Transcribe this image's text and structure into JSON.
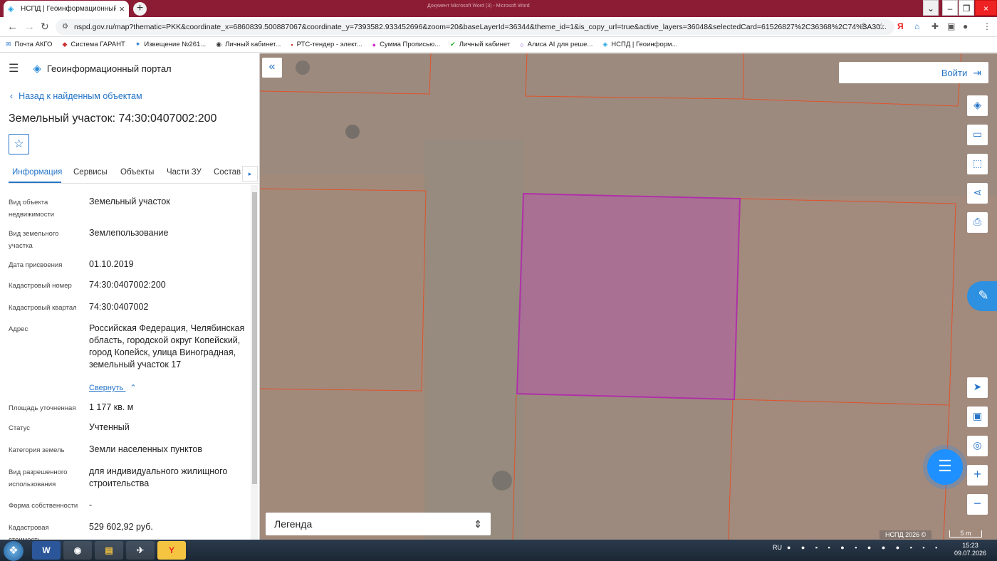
{
  "browser": {
    "tab_title": "НСПД | Геоинформационный п",
    "window_title": "Документ Microsoft Word (3) - Microsoft Word",
    "url": "nspd.gov.ru/map?thematic=PKK&coordinate_x=6860839.500887067&coordinate_y=7393582.933452696&zoom=20&baseLayerId=36344&theme_id=1&is_copy_url=true&active_layers=36048&selectedCard=61526827%2C36368%2C74%3A30..."
  },
  "bookmarks": [
    {
      "label": "Почта АКГО"
    },
    {
      "label": "Система ГАРАНТ"
    },
    {
      "label": "Извещение №261..."
    },
    {
      "label": "Личный кабинет..."
    },
    {
      "label": "РТС-тендер - элект..."
    },
    {
      "label": "Сумма Прописью..."
    },
    {
      "label": "Личный кабинет"
    },
    {
      "label": "Алиса AI для реше..."
    },
    {
      "label": "НСПД | Геоинформ..."
    }
  ],
  "portal": {
    "title": "Геоинформационный портал"
  },
  "panel": {
    "back_link": "Назад к найденным объектам",
    "title": "Земельный участок: 74:30:0407002:200",
    "tabs": [
      "Информация",
      "Сервисы",
      "Объекты",
      "Части ЗУ",
      "Состав"
    ],
    "collapse_link": "Свернуть",
    "rows": [
      {
        "label": "Вид объекта недвижимости",
        "value": "Земельный участок"
      },
      {
        "label": "Вид земельного участка",
        "value": "Землепользование"
      },
      {
        "label": "Дата присвоения",
        "value": "01.10.2019"
      },
      {
        "label": "Кадастровый номер",
        "value": "74:30:0407002:200"
      },
      {
        "label": "Кадастровый квартал",
        "value": "74:30:0407002"
      },
      {
        "label": "Адрес",
        "value": "Российская Федерация, Челябинская область, городской округ Копейский, город Копейск, улица Виноградная, земельный участок 17"
      },
      {
        "label": "Площадь уточненная",
        "value": "1 177 кв. м"
      },
      {
        "label": "Статус",
        "value": "Учтенный"
      },
      {
        "label": "Категория земель",
        "value": "Земли населенных пунктов"
      },
      {
        "label": "Вид разрешенного использования",
        "value": "для индивидуального жилищного строительства"
      },
      {
        "label": "Форма собственности",
        "value": "-"
      },
      {
        "label": "Кадастровая стоимость",
        "value": "529 602,92 руб."
      }
    ]
  },
  "map": {
    "login_label": "Войти",
    "legend_label": "Легенда",
    "credit": "НСПД 2026 ©",
    "scale_label": "5 m",
    "parcel_color": "#b84fb0",
    "boundary_color": "#e0522a"
  },
  "taskbar": {
    "lang": "RU",
    "time": "15:23",
    "date": "09.07.2026"
  }
}
